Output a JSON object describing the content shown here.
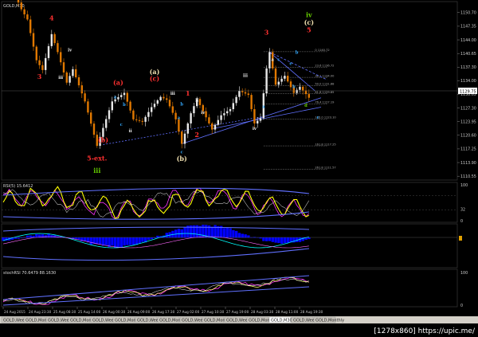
{
  "window": {
    "title": "GOLD,M30",
    "tabs": [
      "GOLD,Weekly",
      "GOLD,Monthly",
      "GOLD,Weekly",
      "GOLD,Monthly",
      "GOLD,Weekly",
      "GOLD,Monthly",
      "GOLD,Weekly",
      "GOLD,Monthly",
      "GOLD,Weekly",
      "GOLD,Monthly",
      "GOLD,Weekly",
      "GOLD,Monthly",
      "GOLD,M30",
      "GOLD,Weekly",
      "GOLD,Monthly"
    ],
    "active_tab_index": 12,
    "watermark": "[1278x860] https://upic.me/"
  },
  "colors": {
    "background": "#000000",
    "bullish": "#e8e8e8",
    "bearish": "#e07800",
    "trendline": "#6070ff",
    "fib": "#7a7a7a",
    "rsi": "#ffff00",
    "macd_hist": "#0000ff"
  },
  "chart_data": [
    {
      "type": "candlestick",
      "name": "GOLD,M30",
      "title": "GOLD,M30",
      "ylim": [
        1110.0,
        1153.0
      ],
      "y_ticks": [
        "1150.70",
        "1147.35",
        "1144.00",
        "1140.65",
        "1137.30",
        "1134.00",
        "1130.65",
        "1127.30",
        "1123.95",
        "1120.60",
        "1117.25",
        "1113.90",
        "1110.55"
      ],
      "current_price": "1129.75",
      "x_ticks": [
        "24 Aug 2015",
        "24 Aug 23:30",
        "25 Aug 08:30",
        "25 Aug 14:00",
        "26 Aug 00:30",
        "26 Aug 09:00",
        "26 Aug 17:30",
        "27 Aug 02:00",
        "27 Aug 10:30",
        "27 Aug 19:00",
        "28 Aug 03:30",
        "28 Aug 11:00",
        "28 Aug 19:30"
      ],
      "close_path": [
        {
          "i": 0,
          "v": 1160.0
        },
        {
          "i": 3,
          "v": 1156.5
        },
        {
          "i": 6,
          "v": 1151.5
        },
        {
          "i": 8,
          "v": 1149.0
        },
        {
          "i": 11,
          "v": 1139.0
        },
        {
          "i": 13,
          "v": 1136.6
        },
        {
          "i": 16,
          "v": 1145.4
        },
        {
          "i": 18,
          "v": 1141.0
        },
        {
          "i": 21,
          "v": 1133.5
        },
        {
          "i": 23,
          "v": 1136.8
        },
        {
          "i": 27,
          "v": 1128.9
        },
        {
          "i": 31,
          "v": 1118.0
        },
        {
          "i": 33,
          "v": 1122.4
        },
        {
          "i": 36,
          "v": 1128.9
        },
        {
          "i": 40,
          "v": 1131.0
        },
        {
          "i": 43,
          "v": 1124.5
        },
        {
          "i": 46,
          "v": 1123.9
        },
        {
          "i": 49,
          "v": 1127.5
        },
        {
          "i": 52,
          "v": 1130.0
        },
        {
          "i": 54,
          "v": 1129.3
        },
        {
          "i": 57,
          "v": 1124.5
        },
        {
          "i": 59,
          "v": 1118.5
        },
        {
          "i": 62,
          "v": 1126.0
        },
        {
          "i": 64,
          "v": 1129.5
        },
        {
          "i": 67,
          "v": 1125.0
        },
        {
          "i": 69,
          "v": 1122.0
        },
        {
          "i": 72,
          "v": 1125.5
        },
        {
          "i": 75,
          "v": 1127.0
        },
        {
          "i": 78,
          "v": 1131.5
        },
        {
          "i": 81,
          "v": 1130.5
        },
        {
          "i": 83,
          "v": 1123.5
        },
        {
          "i": 85,
          "v": 1124.8
        },
        {
          "i": 87,
          "v": 1137.0
        },
        {
          "i": 88,
          "v": 1141.0
        },
        {
          "i": 90,
          "v": 1133.0
        },
        {
          "i": 93,
          "v": 1135.2
        },
        {
          "i": 96,
          "v": 1131.0
        },
        {
          "i": 98,
          "v": 1132.5
        },
        {
          "i": 101,
          "v": 1129.8
        }
      ],
      "wave_labels": [
        {
          "text": "4",
          "i": 16,
          "y": 1148.8,
          "color": "#ff3030"
        },
        {
          "text": "3",
          "i": 12,
          "y": 1134.4,
          "color": "#ff3030"
        },
        {
          "text": "5-ext.",
          "i": 31,
          "y": 1114.4,
          "color": "#ff3030"
        },
        {
          "text": "iii",
          "i": 31,
          "y": 1111.4,
          "color": "#66cc00"
        },
        {
          "text": "(a)",
          "i": 38,
          "y": 1133.0,
          "color": "#ff3030"
        },
        {
          "text": "(a)",
          "i": 50,
          "y": 1135.6,
          "color": "#f0e0b0"
        },
        {
          "text": "(c)",
          "i": 50,
          "y": 1133.9,
          "color": "#ff3030"
        },
        {
          "text": "(b)",
          "i": 33,
          "y": 1118.9,
          "color": "#ff3030"
        },
        {
          "text": "(b)",
          "i": 59,
          "y": 1114.3,
          "color": "#f0e0b0"
        },
        {
          "text": "1",
          "i": 61,
          "y": 1130.3,
          "color": "#ff3030"
        },
        {
          "text": "2",
          "i": 64,
          "y": 1120.2,
          "color": "#ff3030"
        },
        {
          "text": "3",
          "i": 87,
          "y": 1145.3,
          "color": "#ff3030"
        },
        {
          "text": "iv",
          "i": 101,
          "y": 1149.6,
          "color": "#66cc00"
        },
        {
          "text": "(c)",
          "i": 101,
          "y": 1147.7,
          "color": "#f0e0b0"
        },
        {
          "text": "5",
          "i": 101,
          "y": 1145.9,
          "color": "#ff3030"
        },
        {
          "text": "iv",
          "i": 22,
          "y": 1141.2,
          "color": "#f0f0f0"
        },
        {
          "text": "iii",
          "i": 19,
          "y": 1134.4,
          "color": "#f0f0f0"
        },
        {
          "text": "iii",
          "i": 80,
          "y": 1134.9,
          "color": "#f0f0f0"
        },
        {
          "text": "iv",
          "i": 83,
          "y": 1121.9,
          "color": "#f0f0f0"
        },
        {
          "text": "ii",
          "i": 42,
          "y": 1121.3,
          "color": "#f0f0f0"
        },
        {
          "text": "iii",
          "i": 56,
          "y": 1130.5,
          "color": "#f0f0f0"
        },
        {
          "text": "ii",
          "i": 64,
          "y": 1128.9,
          "color": "#f0f0f0"
        },
        {
          "text": "iv",
          "i": 66,
          "y": 1125.8,
          "color": "#f0f0f0"
        },
        {
          "text": "a",
          "i": 37,
          "y": 1129.6,
          "color": "#33aaff"
        },
        {
          "text": "b",
          "i": 40,
          "y": 1127.8,
          "color": "#33aaff"
        },
        {
          "text": "c",
          "i": 39,
          "y": 1122.9,
          "color": "#33aaff"
        },
        {
          "text": "a",
          "i": 58,
          "y": 1124.6,
          "color": "#33aaff"
        },
        {
          "text": "b",
          "i": 59,
          "y": 1127.9,
          "color": "#33aaff"
        },
        {
          "text": "c",
          "i": 59,
          "y": 1116.2,
          "color": "#33aaff"
        },
        {
          "text": "a",
          "i": 86,
          "y": 1127.3,
          "color": "#33aaff"
        },
        {
          "text": "a",
          "i": 89,
          "y": 1138.8,
          "color": "#f0f0f0"
        },
        {
          "text": "c",
          "i": 91,
          "y": 1138.8,
          "color": "#33aaff"
        },
        {
          "text": "e",
          "i": 95,
          "y": 1137.9,
          "color": "#33aaff"
        },
        {
          "text": "b",
          "i": 97,
          "y": 1140.6,
          "color": "#33aaff"
        },
        {
          "text": "d",
          "i": 100,
          "y": 1127.6,
          "color": "#66cc00"
        },
        {
          "text": "c",
          "i": 104,
          "y": 1124.7,
          "color": "#33aaff"
        },
        {
          "text": "b",
          "i": 96,
          "y": 1132.2,
          "color": "#33aaff"
        }
      ],
      "fib_levels": [
        {
          "label": "0  1140.72",
          "y": 1141.1
        },
        {
          "label": "23.6  1136.72",
          "y": 1137.3
        },
        {
          "label": "38.2  1134.00",
          "y": 1134.8
        },
        {
          "label": "50.0  1131.88",
          "y": 1132.8
        },
        {
          "label": "61.8  1129.85",
          "y": 1130.8
        },
        {
          "label": "76.4  1127.19",
          "y": 1128.3
        },
        {
          "label": "100.0  1123.10",
          "y": 1124.6
        },
        {
          "label": "161.8  1117.25",
          "y": 1118.0
        },
        {
          "label": "261.8  1111.57",
          "y": 1112.3
        }
      ]
    },
    {
      "type": "line",
      "name": "RSI(5)",
      "title": "RSI(5) 15.6412",
      "ylim": [
        0,
        100
      ],
      "y_ticks": [
        "100",
        "32",
        "0"
      ],
      "levels": [
        70,
        30
      ]
    },
    {
      "type": "bar",
      "name": "MACD",
      "title": "",
      "y_ticks": []
    },
    {
      "type": "line",
      "name": "StochRSI",
      "title": "stochRSI 70.6479 88.1630",
      "ylim": [
        0,
        100
      ],
      "y_ticks": [
        "100",
        "0"
      ]
    }
  ]
}
